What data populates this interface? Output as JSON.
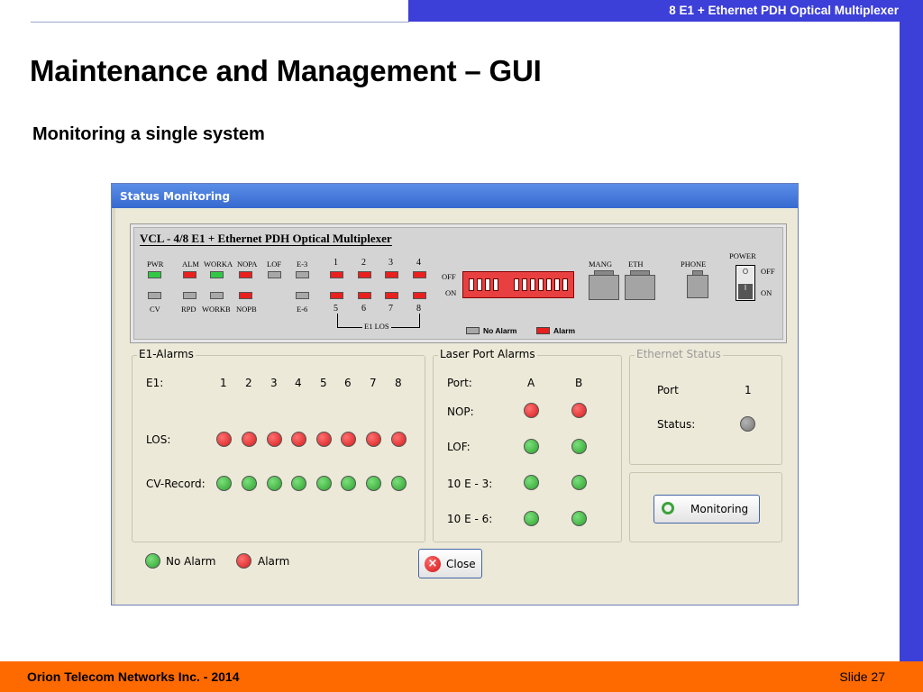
{
  "slide": {
    "header": "8 E1 + Ethernet PDH Optical Multiplexer",
    "title": "Maintenance and Management – GUI",
    "subtitle": "Monitoring a single system",
    "footer_company": "Orion Telecom Networks Inc. - 2014",
    "footer_slide": "Slide 27"
  },
  "window": {
    "title": "Status Monitoring",
    "panel": {
      "title": "VCL - 4/8 E1 + Ethernet PDH Optical Multiplexer",
      "top_labels": [
        "PWR",
        "ALM",
        "WORKA",
        "NOPA",
        "LOF",
        "E-3",
        "1",
        "2",
        "3",
        "4"
      ],
      "bottom_labels": [
        "CV",
        "RPD",
        "WORKB",
        "NOPB",
        "E-6",
        "5",
        "6",
        "7",
        "8"
      ],
      "e1_los": "E1 LOS",
      "off": "OFF",
      "on": "ON",
      "mang": "MANG",
      "eth": "ETH",
      "phone": "PHONE",
      "power": "POWER",
      "power_off": "OFF",
      "power_on": "ON",
      "switch_off": "O",
      "switch_on": "I",
      "legend_no_alarm": "No Alarm",
      "legend_alarm": "Alarm"
    },
    "e1_alarms": {
      "title": "E1-Alarms",
      "e1_label": "E1:",
      "ports": [
        "1",
        "2",
        "3",
        "4",
        "5",
        "6",
        "7",
        "8"
      ],
      "los_label": "LOS:",
      "cv_label": "CV-Record:",
      "los_states": [
        "alarm",
        "alarm",
        "alarm",
        "alarm",
        "alarm",
        "alarm",
        "alarm",
        "alarm"
      ],
      "cv_states": [
        "no-alarm",
        "no-alarm",
        "no-alarm",
        "no-alarm",
        "no-alarm",
        "no-alarm",
        "no-alarm",
        "no-alarm"
      ]
    },
    "laser": {
      "title": "Laser Port Alarms",
      "port_label": "Port:",
      "col_a": "A",
      "col_b": "B",
      "nop": "NOP:",
      "lof": "LOF:",
      "e3": "10 E - 3:",
      "e6": "10 E - 6:"
    },
    "ethernet": {
      "title": "Ethernet Status",
      "port_label": "Port",
      "port_value": "1",
      "status_label": "Status:"
    },
    "legend": {
      "no_alarm": "No Alarm",
      "alarm": "Alarm"
    },
    "buttons": {
      "monitoring": "Monitoring",
      "close": "Close"
    }
  },
  "colors": {
    "accent_blue": "#3c3fd8",
    "footer_orange": "#ff6a00",
    "led_green": "#32c846",
    "led_red": "#e8201e"
  }
}
